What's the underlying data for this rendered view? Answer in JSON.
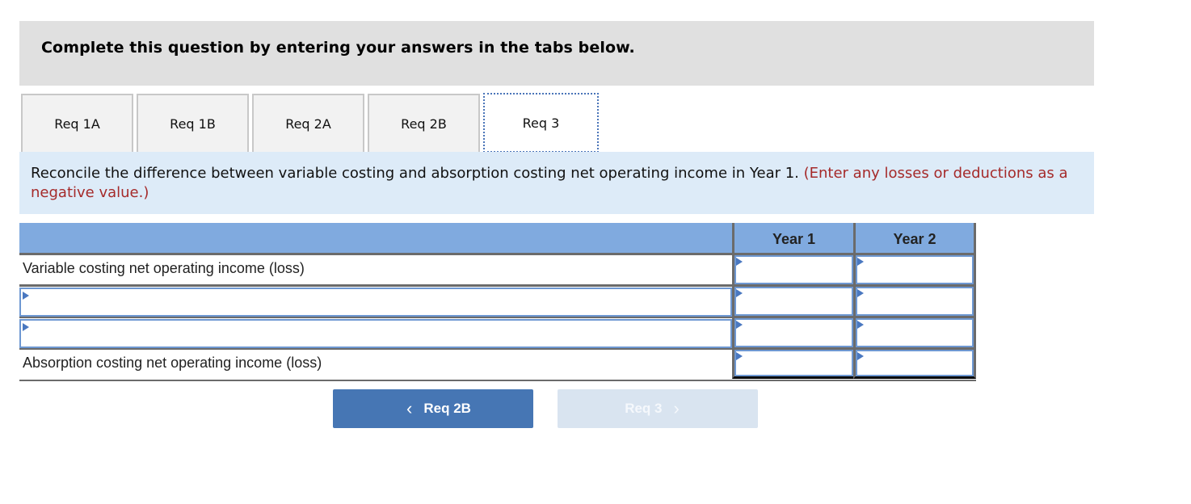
{
  "instructions": "Complete this question by entering your answers in the tabs below.",
  "tabs": [
    {
      "label": "Req 1A",
      "active": false
    },
    {
      "label": "Req 1B",
      "active": false
    },
    {
      "label": "Req 2A",
      "active": false
    },
    {
      "label": "Req 2B",
      "active": false
    },
    {
      "label": "Req 3",
      "active": true
    }
  ],
  "prompt": {
    "text": "Reconcile the difference between variable costing and absorption costing net operating income in Year 1.",
    "note": "(Enter any losses or deductions as a negative value.)"
  },
  "table": {
    "columns": [
      "Year 1",
      "Year 2"
    ],
    "rows": [
      {
        "label": "Variable costing net operating income (loss)",
        "editable_label": false,
        "label_value": "",
        "year1": "",
        "year2": ""
      },
      {
        "label": "",
        "editable_label": true,
        "label_value": "",
        "year1": "",
        "year2": ""
      },
      {
        "label": "",
        "editable_label": true,
        "label_value": "",
        "year1": "",
        "year2": ""
      },
      {
        "label": "Absorption costing net operating income (loss)",
        "editable_label": false,
        "label_value": "",
        "year1": "",
        "year2": ""
      }
    ]
  },
  "nav": {
    "prev_label": "Req 2B",
    "next_label": "Req 3",
    "prev_icon": "chevron-left-icon",
    "next_icon": "chevron-right-icon",
    "next_disabled": true
  },
  "colors": {
    "accent": "#4676b4",
    "header_blue": "#80aadf",
    "prompt_bg": "#ddebf8",
    "note_red": "#a52a2a"
  }
}
